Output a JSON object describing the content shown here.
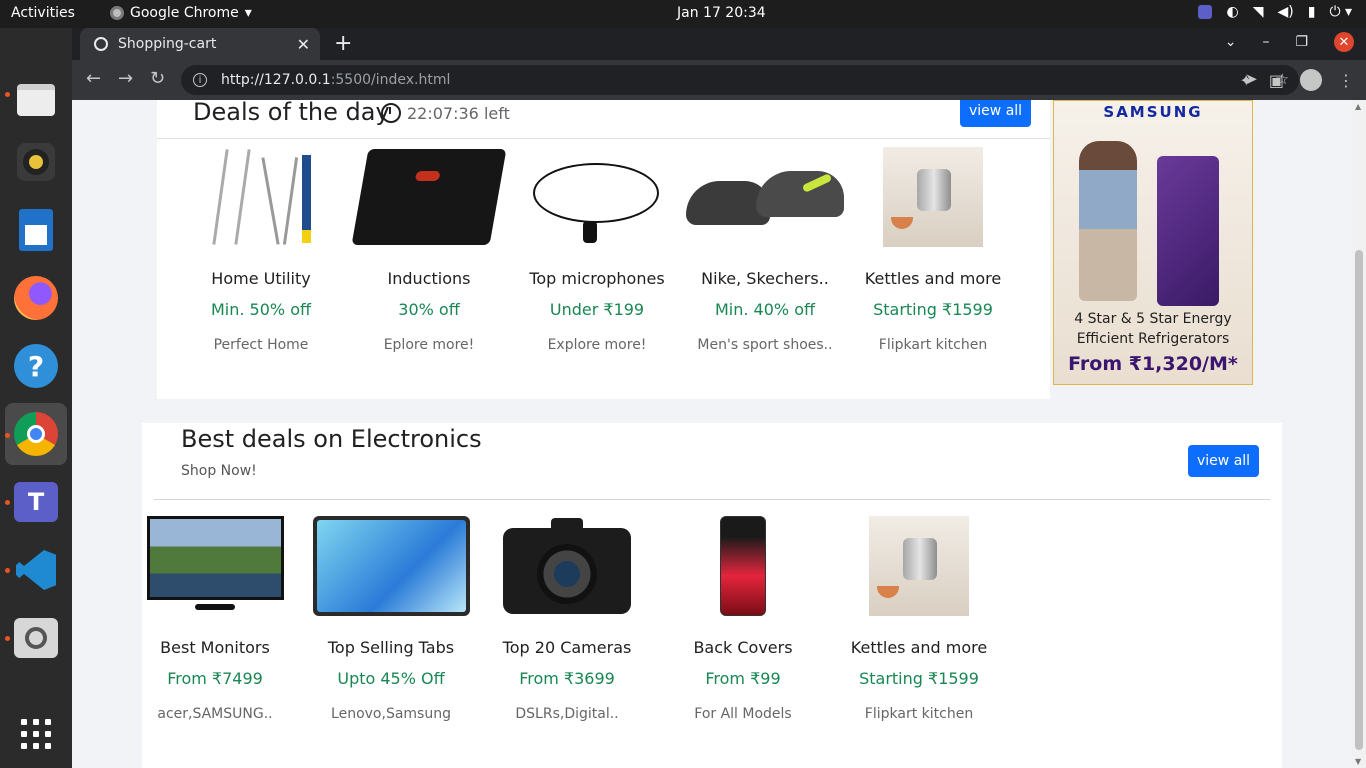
{
  "system": {
    "activities": "Activities",
    "app_name": "Google Chrome",
    "clock": "Jan 17  20:34"
  },
  "browser": {
    "tab_title": "Shopping-cart",
    "url_host": "http://127.0.0.1",
    "url_rest": ":5500/index.html"
  },
  "deals": {
    "title": "Deals of the day",
    "timer": "22:07:36 left",
    "view_all": "view all",
    "items": [
      {
        "name": "Home Utility",
        "offer": "Min. 50% off",
        "sub": "Perfect Home"
      },
      {
        "name": "Inductions",
        "offer": "30% off",
        "sub": "Eplore more!"
      },
      {
        "name": "Top microphones",
        "offer": "Under ₹199",
        "sub": "Explore more!"
      },
      {
        "name": "Nike, Skechers..",
        "offer": "Min. 40% off",
        "sub": "Men's sport shoes.."
      },
      {
        "name": "Kettles and more",
        "offer": "Starting ₹1599",
        "sub": "Flipkart kitchen"
      }
    ]
  },
  "ad": {
    "brand": "SAMSUNG",
    "line1": "4 Star & 5 Star Energy Efficient Refrigerators",
    "price": "From ₹1,320/M*"
  },
  "electronics": {
    "title": "Best deals on Electronics",
    "subtitle": "Shop Now!",
    "view_all": "view all",
    "items": [
      {
        "name": "Best Monitors",
        "offer": "From ₹7499",
        "sub": "acer,SAMSUNG.."
      },
      {
        "name": "Top Selling Tabs",
        "offer": "Upto 45% Off",
        "sub": "Lenovo,Samsung"
      },
      {
        "name": "Top 20 Cameras",
        "offer": "From ₹3699",
        "sub": "DSLRs,Digital.."
      },
      {
        "name": "Back Covers",
        "offer": "From ₹99",
        "sub": "For All Models"
      },
      {
        "name": "Kettles and more",
        "offer": "Starting ₹1599",
        "sub": "Flipkart kitchen"
      }
    ]
  },
  "colors": {
    "accent": "#0d6efd",
    "offer_green": "#198754"
  }
}
